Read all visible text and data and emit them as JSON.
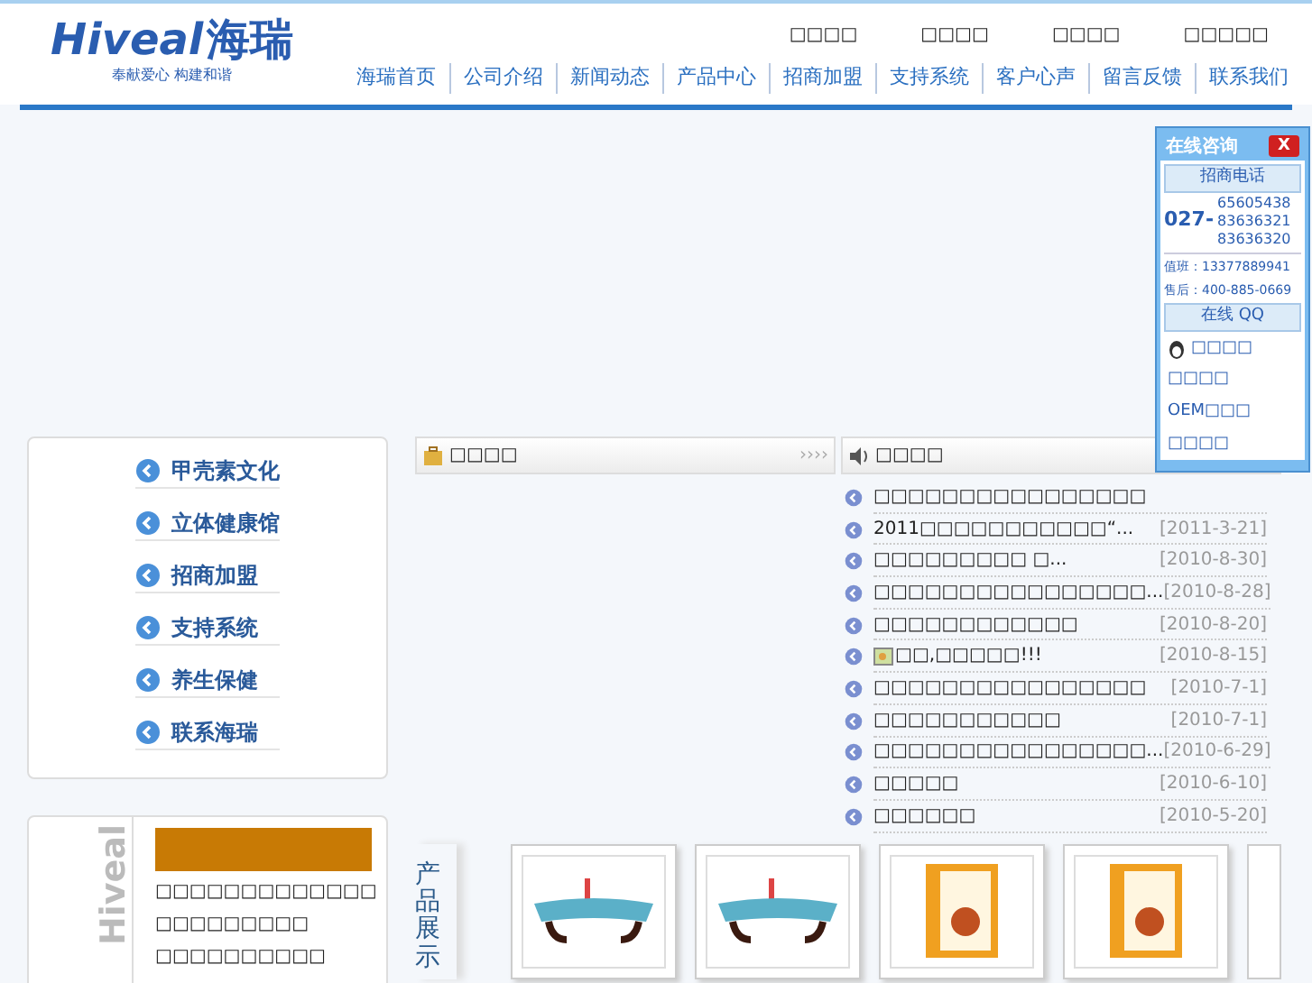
{
  "logo": {
    "brand_latin": "Hiveal",
    "brand_cn": "海瑞",
    "tagline": "奉献爱心 构建和谐"
  },
  "top_links": [
    "□□□□",
    "□□□□",
    "□□□□",
    "□□□□□"
  ],
  "nav": [
    "海瑞首页",
    "公司介绍",
    "新闻动态",
    "产品中心",
    "招商加盟",
    "支持系统",
    "客户心声",
    "留言反馈",
    "联系我们"
  ],
  "side_menu": [
    "甲壳素文化",
    "立体健康馆",
    "招商加盟",
    "支持系统",
    "养生保健",
    "联系海瑞"
  ],
  "company_panel": {
    "title": "□□□□",
    "more": "››››"
  },
  "news": {
    "title": "□□□□",
    "items": [
      {
        "text": "□□□□□□□□□□□□□□□□"
      },
      {
        "text": "2011□□□□□□□□□□□“...",
        "date": "[2011-3-21]"
      },
      {
        "text": "□□□□□□□□□ □...",
        "date": "[2010-8-30]"
      },
      {
        "text": "□□□□□□□□□□□□□□□□...",
        "date": "[2010-8-28]"
      },
      {
        "text": "□□□□□□□□□□□□",
        "date": "[2010-8-20]"
      },
      {
        "text": "□□,□□□□□!!!",
        "date": "[2010-8-15]",
        "has_image": true
      },
      {
        "text": "□□□□□□□□□□□□□□□□",
        "date": "[2010-7-1]"
      },
      {
        "text": "□□□□□□□□□□□",
        "date": "[2010-7-1]"
      },
      {
        "text": "□□□□□□□□□□□□□□□□...",
        "date": "[2010-6-29]"
      },
      {
        "text": "□□□□□",
        "date": "[2010-6-10]"
      },
      {
        "text": "□□□□□□",
        "date": "[2010-5-20]"
      }
    ]
  },
  "chat": {
    "title": "在线咨询",
    "close": "X",
    "hotline_label": "招商电话",
    "area_code": "027-",
    "numbers": [
      "65605438",
      "83636321",
      "83636320"
    ],
    "duty": "值班：13377889941",
    "after_sales": "售后：400-885-0669",
    "qq_label": "在线 QQ",
    "contacts": [
      "□□□□",
      "□□□□",
      "OEM□□□",
      "□□□□"
    ]
  },
  "bottom_box": {
    "logo_text": "Hiveal",
    "lines": [
      "□□□□□□□□□□□□□",
      "□□□□□□□□□",
      "□□□□□□□□□□"
    ]
  },
  "products": {
    "title": "产品展示",
    "items": [
      {
        "kind": "bed"
      },
      {
        "kind": "bed"
      },
      {
        "kind": "box"
      },
      {
        "kind": "box"
      }
    ]
  }
}
